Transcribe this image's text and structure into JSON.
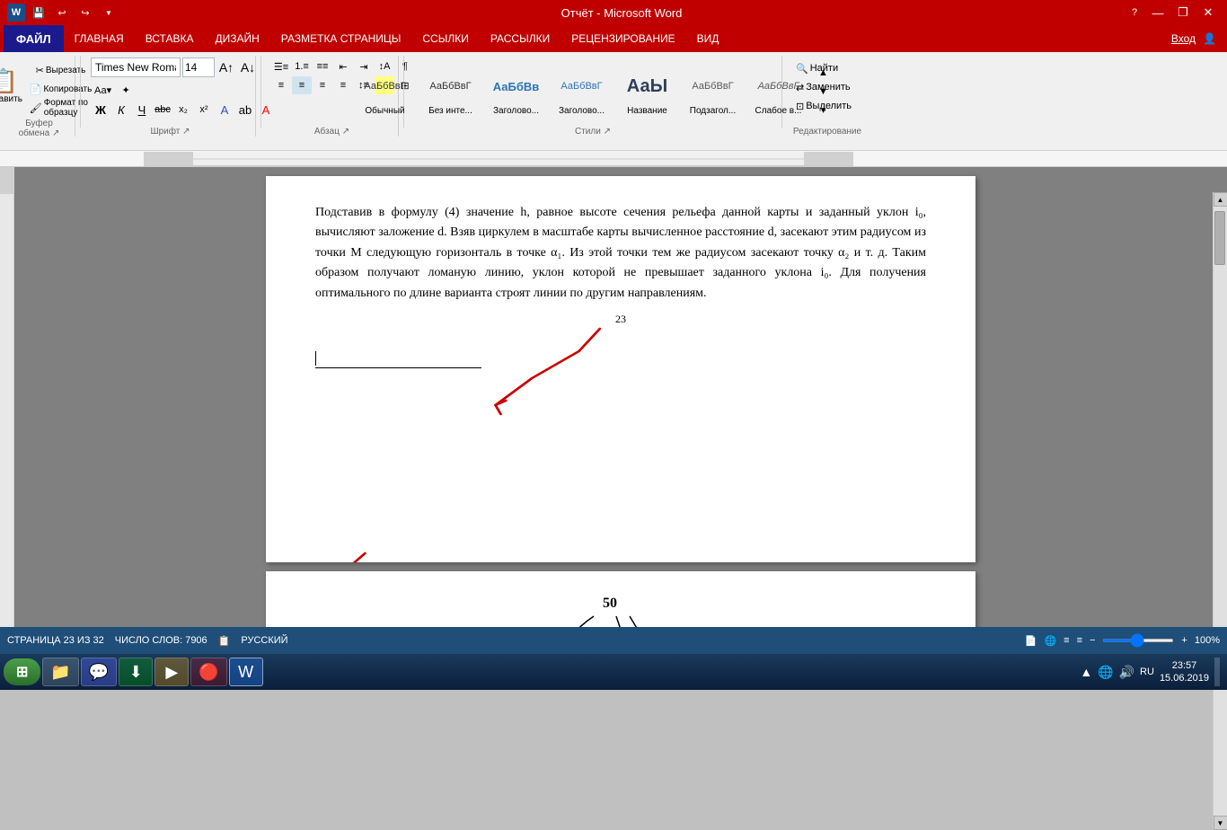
{
  "titlebar": {
    "title": "Отчёт - Microsoft Word",
    "minimize": "—",
    "restore": "❐",
    "close": "✕",
    "help": "?"
  },
  "quickaccess": {
    "save": "💾",
    "undo": "↩",
    "redo": "↪"
  },
  "menubar": {
    "file": "ФАЙЛ",
    "home": "ГЛАВНАЯ",
    "insert": "ВСТАВКА",
    "design": "ДИЗАЙН",
    "layout": "РАЗМЕТКА СТРАНИЦЫ",
    "refs": "ССЫЛКИ",
    "mailings": "РАССЫЛКИ",
    "review": "РЕЦЕНЗИРОВАНИЕ",
    "view": "ВИД",
    "login": "Вход"
  },
  "ribbon": {
    "clipboard": {
      "paste_label": "Вставить",
      "cut_label": "Вырезать",
      "copy_label": "Копировать",
      "format_label": "Формат по образцу",
      "group_label": "Буфер обмена"
    },
    "font": {
      "font_name": "Times New Roman",
      "font_size": "14",
      "bold": "Ж",
      "italic": "К",
      "underline": "Ч",
      "strikethrough": "abc",
      "sub": "x₂",
      "sup": "x²",
      "group_label": "Шрифт"
    },
    "paragraph": {
      "group_label": "Абзац"
    },
    "styles": {
      "items": [
        {
          "label": "Обычный",
          "preview": "АаБбВвГ"
        },
        {
          "label": "Без инте...",
          "preview": "АаБбВвГ"
        },
        {
          "label": "Заголово...",
          "preview": "АаБбВв"
        },
        {
          "label": "Заголово...",
          "preview": "АаБбВвГ"
        },
        {
          "label": "Название",
          "preview": "АаЫ"
        },
        {
          "label": "Подзагол...",
          "preview": "АаБбВвГ"
        },
        {
          "label": "Слабое в...",
          "preview": "АаБбВвГ"
        }
      ],
      "group_label": "Стили"
    },
    "editing": {
      "find_label": "Найти",
      "replace_label": "Заменить",
      "select_label": "Выделить",
      "group_label": "Редактирование"
    }
  },
  "document": {
    "page23_text": "Подставив в формулу (4) значение h, равное высоте сечения рельефа данной карты и заданный уклон i₀, вычисляют заложение d. Взяв циркулем в масштабе карты вычисленное расстояние d, засекают этим радиусом из точки M следующую горизонталь в точке α₁. Из этой точки тем же радиусом засекают точку α₂ и т. д. Таким образом получают ломаную линию, уклон которой не превышает заданного уклона i₀. Для получения оптимального по длине варианта строят линии по другим направлениям.",
    "page_number_23": "23",
    "page_number_24_content": "50"
  },
  "statusbar": {
    "page_info": "СТРАНИЦА 23 ИЗ 32",
    "word_count": "ЧИСЛО СЛОВ: 7906",
    "language": "РУССКИЙ",
    "zoom_level": "100%"
  },
  "taskbar": {
    "start_label": "start",
    "clock_time": "23:57",
    "clock_date": "15.06.2019",
    "lang": "RU"
  }
}
